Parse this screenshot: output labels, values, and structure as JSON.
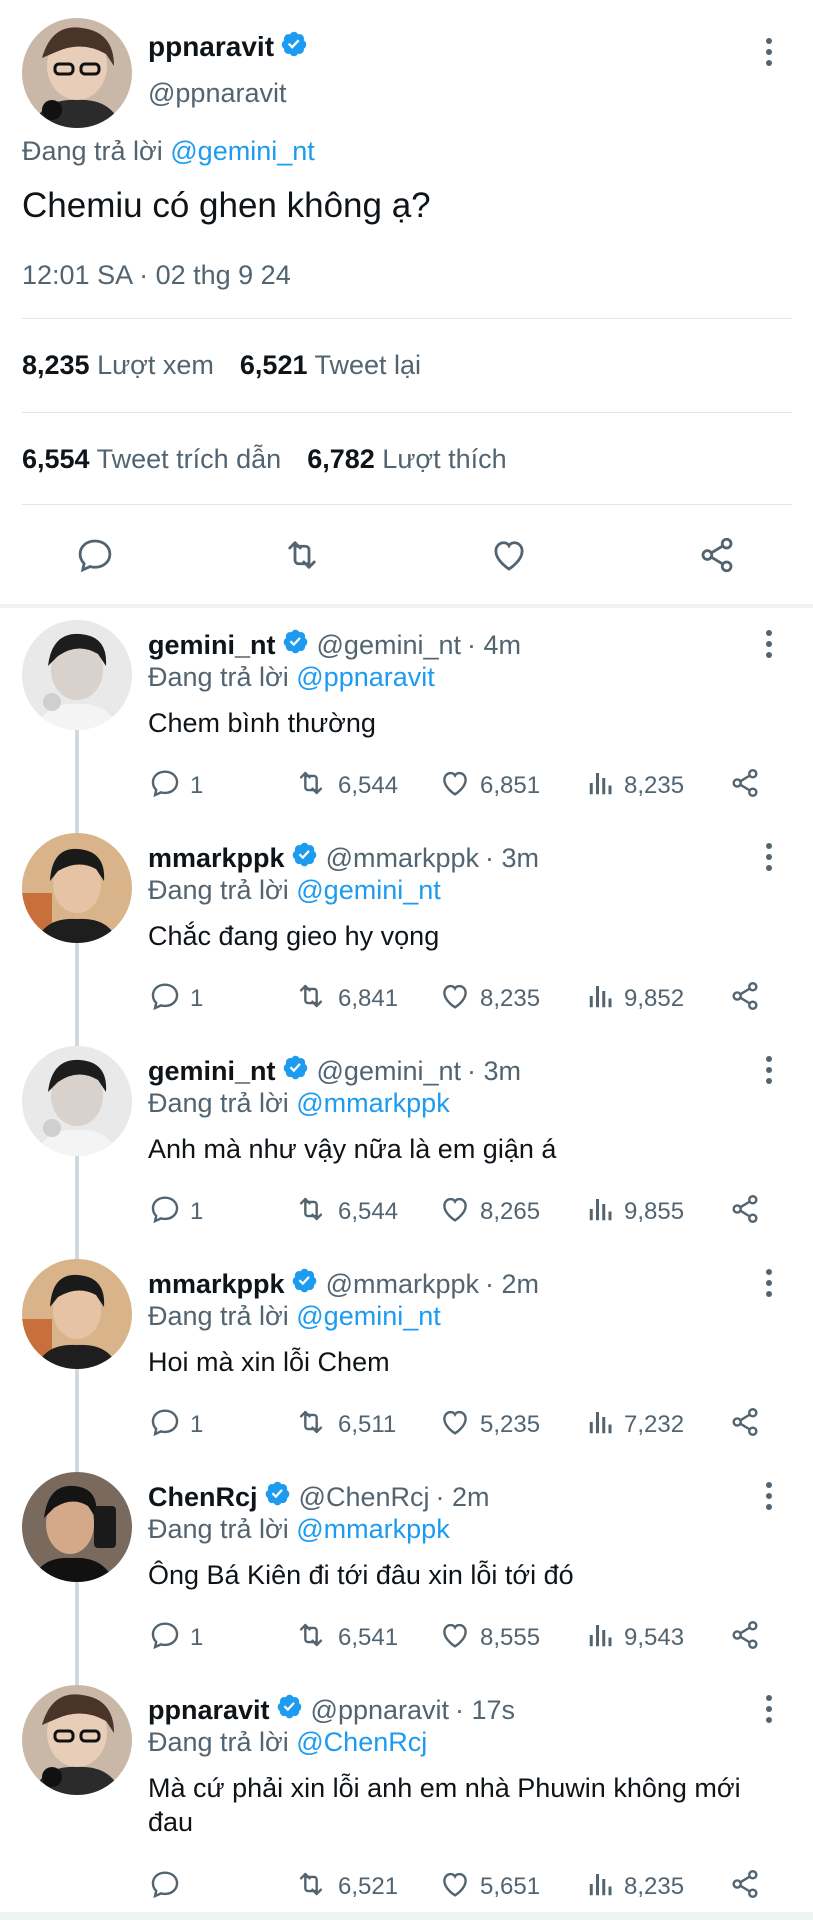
{
  "main_tweet": {
    "display_name": "ppnaravit",
    "handle": "@ppnaravit",
    "replying_prefix": "Đang trả lời ",
    "replying_to": "@gemini_nt",
    "text": "Chemiu có ghen không ạ?",
    "timestamp": "12:01 SA · 02 thg 9 24",
    "stats": {
      "views_count": "8,235",
      "views_label": "Lượt xem",
      "retweets_count": "6,521",
      "retweets_label": "Tweet lại",
      "quotes_count": "6,554",
      "quotes_label": "Tweet trích dẫn",
      "likes_count": "6,782",
      "likes_label": "Lượt thích"
    }
  },
  "colors": {
    "accent": "#1d9bf0",
    "secondary_text": "#536471",
    "primary_text": "#0f1419",
    "divider": "#e1e6ea",
    "thread_line": "#cfd9de"
  },
  "replies": [
    {
      "display_name": "gemini_nt",
      "handle": "@gemini_nt",
      "time": "· 4m",
      "replying_prefix": "Đang trả lời ",
      "replying_to": "@ppnaravit",
      "text": "Chem bình thường",
      "reply_count": "1",
      "retweet_count": "6,544",
      "like_count": "6,851",
      "view_count": "8,235"
    },
    {
      "display_name": "mmarkppk",
      "handle": "@mmarkppk",
      "time": "· 3m",
      "replying_prefix": "Đang trả lời ",
      "replying_to": "@gemini_nt",
      "text": "Chắc đang gieo hy vọng",
      "reply_count": "1",
      "retweet_count": "6,841",
      "like_count": "8,235",
      "view_count": "9,852"
    },
    {
      "display_name": "gemini_nt",
      "handle": "@gemini_nt",
      "time": "· 3m",
      "replying_prefix": "Đang trả lời ",
      "replying_to": "@mmarkppk",
      "text": "Anh mà như vậy nữa là em giận á",
      "reply_count": "1",
      "retweet_count": "6,544",
      "like_count": "8,265",
      "view_count": "9,855"
    },
    {
      "display_name": "mmarkppk",
      "handle": "@mmarkppk",
      "time": "· 2m",
      "replying_prefix": "Đang trả lời ",
      "replying_to": "@gemini_nt",
      "text": "Hoi mà xin lỗi Chem",
      "reply_count": "1",
      "retweet_count": "6,511",
      "like_count": "5,235",
      "view_count": "7,232"
    },
    {
      "display_name": "ChenRcj",
      "handle": "@ChenRcj",
      "time": "· 2m",
      "replying_prefix": "Đang trả lời ",
      "replying_to": "@mmarkppk",
      "text": "Ông Bá Kiên đi tới đâu xin lỗi tới đó",
      "reply_count": "1",
      "retweet_count": "6,541",
      "like_count": "8,555",
      "view_count": "9,543"
    },
    {
      "display_name": "ppnaravit",
      "handle": "@ppnaravit",
      "time": "· 17s",
      "replying_prefix": "Đang trả lời ",
      "replying_to": "@ChenRcj",
      "text": "Mà cứ phải xin lỗi anh em nhà Phuwin không mới đau",
      "reply_count": "",
      "retweet_count": "6,521",
      "like_count": "5,651",
      "view_count": "8,235"
    }
  ]
}
